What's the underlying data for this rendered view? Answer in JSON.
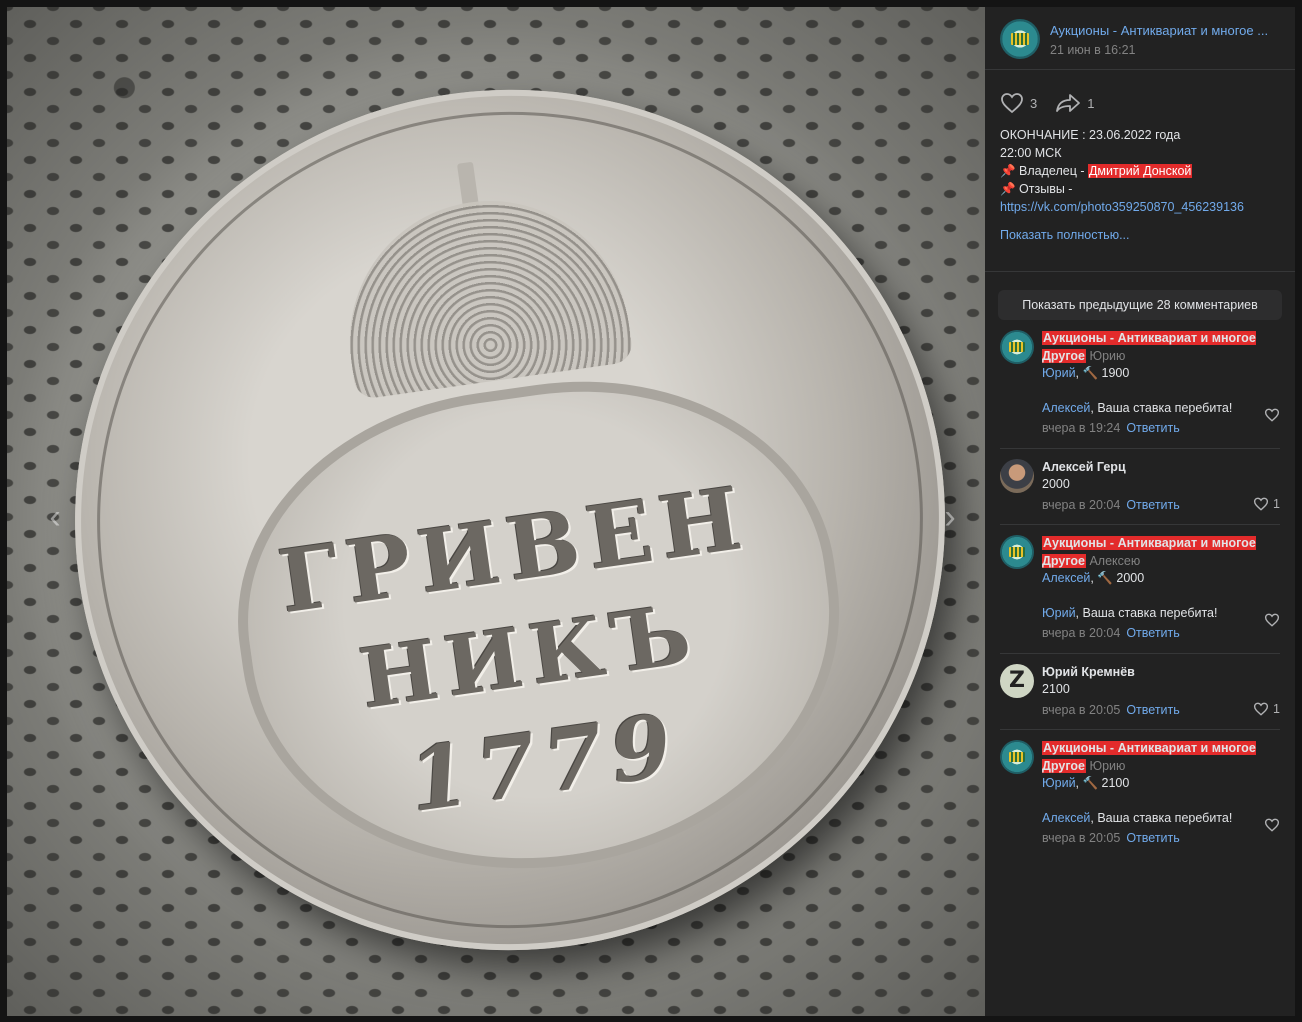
{
  "photo": {
    "coin_line1": "ГРИВЕН",
    "coin_line2": "НИКЪ",
    "coin_line3": "1779",
    "prev_arrow": "‹",
    "next_arrow": "›"
  },
  "header": {
    "title": "Аукционы - Антиквариат и многое ...",
    "date": "21 июн в 16:21"
  },
  "actions": {
    "likes": "3",
    "shares": "1"
  },
  "post": {
    "line1": "ОКОНЧАНИЕ : 23.06.2022 года",
    "line2": "22:00 МСК",
    "owner_prefix": "📌 Владелец - ",
    "owner_name": "Дмитрий Донской",
    "reviews": "📌 Отзывы -",
    "link": "https://vk.com/photo359250870_456239136",
    "show_more": "Показать полностью..."
  },
  "comments_button": "Показать предыдущие 28 комментариев",
  "comments": [
    {
      "author": "Аукционы - Антиквариат и многое Другое",
      "to": "Юрию",
      "mention": "Юрий",
      "text": ", 🔨 1900",
      "mention2": "Алексей",
      "text2": ", Ваша ставка перебита!",
      "time": "вчера в 19:24",
      "reply": "Ответить",
      "likes": ""
    },
    {
      "author": "Алексей Герц",
      "text": "2000",
      "time": "вчера в 20:04",
      "reply": "Ответить",
      "likes": "1"
    },
    {
      "author": "Аукционы - Антиквариат и многое Другое",
      "to": "Алексею",
      "mention": "Алексей",
      "text": ", 🔨 2000",
      "mention2": "Юрий",
      "text2": ", Ваша ставка перебита!",
      "time": "вчера в 20:04",
      "reply": "Ответить",
      "likes": ""
    },
    {
      "author": "Юрий Кремнёв",
      "avatar_letter": "Z",
      "text": "2100",
      "time": "вчера в 20:05",
      "reply": "Ответить",
      "likes": "1"
    },
    {
      "author": "Аукционы - Антиквариат и многое Другое",
      "to": "Юрию",
      "mention": "Юрий",
      "text": ", 🔨 2100",
      "mention2": "Алексей",
      "text2": ", Ваша ставка перебита!",
      "time": "вчера в 20:05",
      "reply": "Ответить",
      "likes": ""
    }
  ],
  "colors": {
    "accent": "#71aaeb",
    "highlight": "#e32b2b",
    "panel": "#222222"
  }
}
